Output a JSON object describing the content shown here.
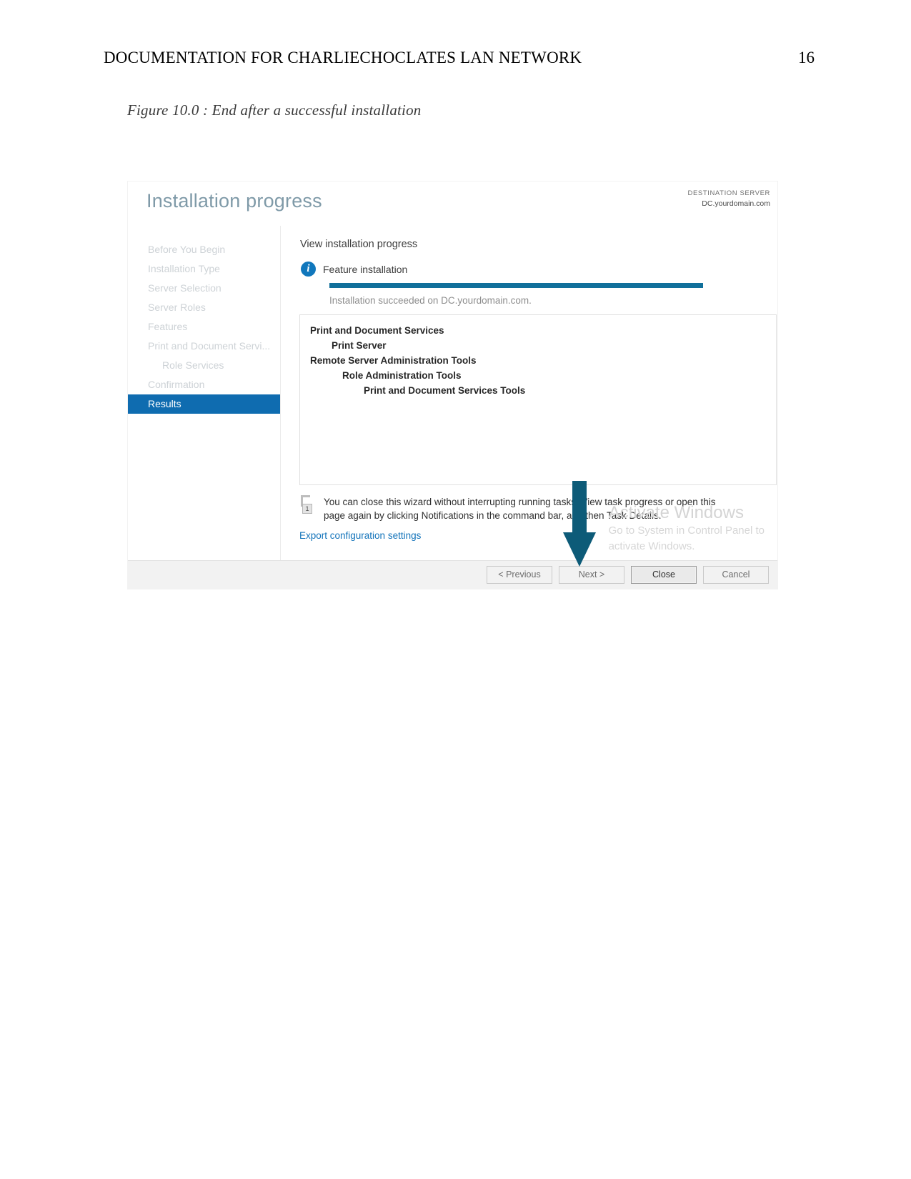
{
  "document": {
    "header_title": "DOCUMENTATION FOR CHARLIECHOCLATES LAN NETWORK",
    "page_number": "16",
    "figure_caption": "Figure 10.0 : End after a successful installation"
  },
  "screenshot": {
    "title": "Installation progress",
    "destination": {
      "label": "DESTINATION SERVER",
      "value": "DC.yourdomain.com"
    },
    "nav": {
      "items": [
        {
          "label": "Before You Begin",
          "level": 0,
          "active": false
        },
        {
          "label": "Installation Type",
          "level": 0,
          "active": false
        },
        {
          "label": "Server Selection",
          "level": 0,
          "active": false
        },
        {
          "label": "Server Roles",
          "level": 0,
          "active": false
        },
        {
          "label": "Features",
          "level": 0,
          "active": false
        },
        {
          "label": "Print and Document Servi...",
          "level": 0,
          "active": false
        },
        {
          "label": "Role Services",
          "level": 1,
          "active": false
        },
        {
          "label": "Confirmation",
          "level": 0,
          "active": false
        },
        {
          "label": "Results",
          "level": 0,
          "active": true
        }
      ]
    },
    "content": {
      "heading": "View installation progress",
      "feature_label": "Feature installation",
      "info_icon": "info-icon",
      "progress_percent": 100,
      "progress_message": "Installation succeeded on DC.yourdomain.com.",
      "results": [
        {
          "text": "Print and Document Services",
          "indent": 0
        },
        {
          "text": "Print Server",
          "indent": 1
        },
        {
          "text": "Remote Server Administration Tools",
          "indent": 0
        },
        {
          "text": "Role Administration Tools",
          "indent": 2
        },
        {
          "text": "Print and Document Services Tools",
          "indent": 3
        }
      ],
      "notice": {
        "badge": "1",
        "line1": "You can close this wizard without interrupting running tasks. View task progress or open this",
        "line2": "page again by clicking Notifications in the command bar, and then Task Details."
      },
      "export_link": "Export configuration settings"
    },
    "footer": {
      "buttons": [
        {
          "label": "< Previous",
          "focused": false
        },
        {
          "label": "Next >",
          "focused": false
        },
        {
          "label": "Close",
          "focused": true
        },
        {
          "label": "Cancel",
          "focused": false
        }
      ]
    },
    "watermark": {
      "title": "Activate Windows",
      "subtitle_line1": "Go to System in Control Panel to",
      "subtitle_line2": "activate Windows."
    },
    "annotation": {
      "arrow_color": "#0d5b78",
      "points_to": "Close"
    },
    "colors": {
      "accent": "#0f6cb0",
      "progress": "#11709b",
      "link": "#1273ba",
      "title": "#7f9aa8"
    }
  }
}
